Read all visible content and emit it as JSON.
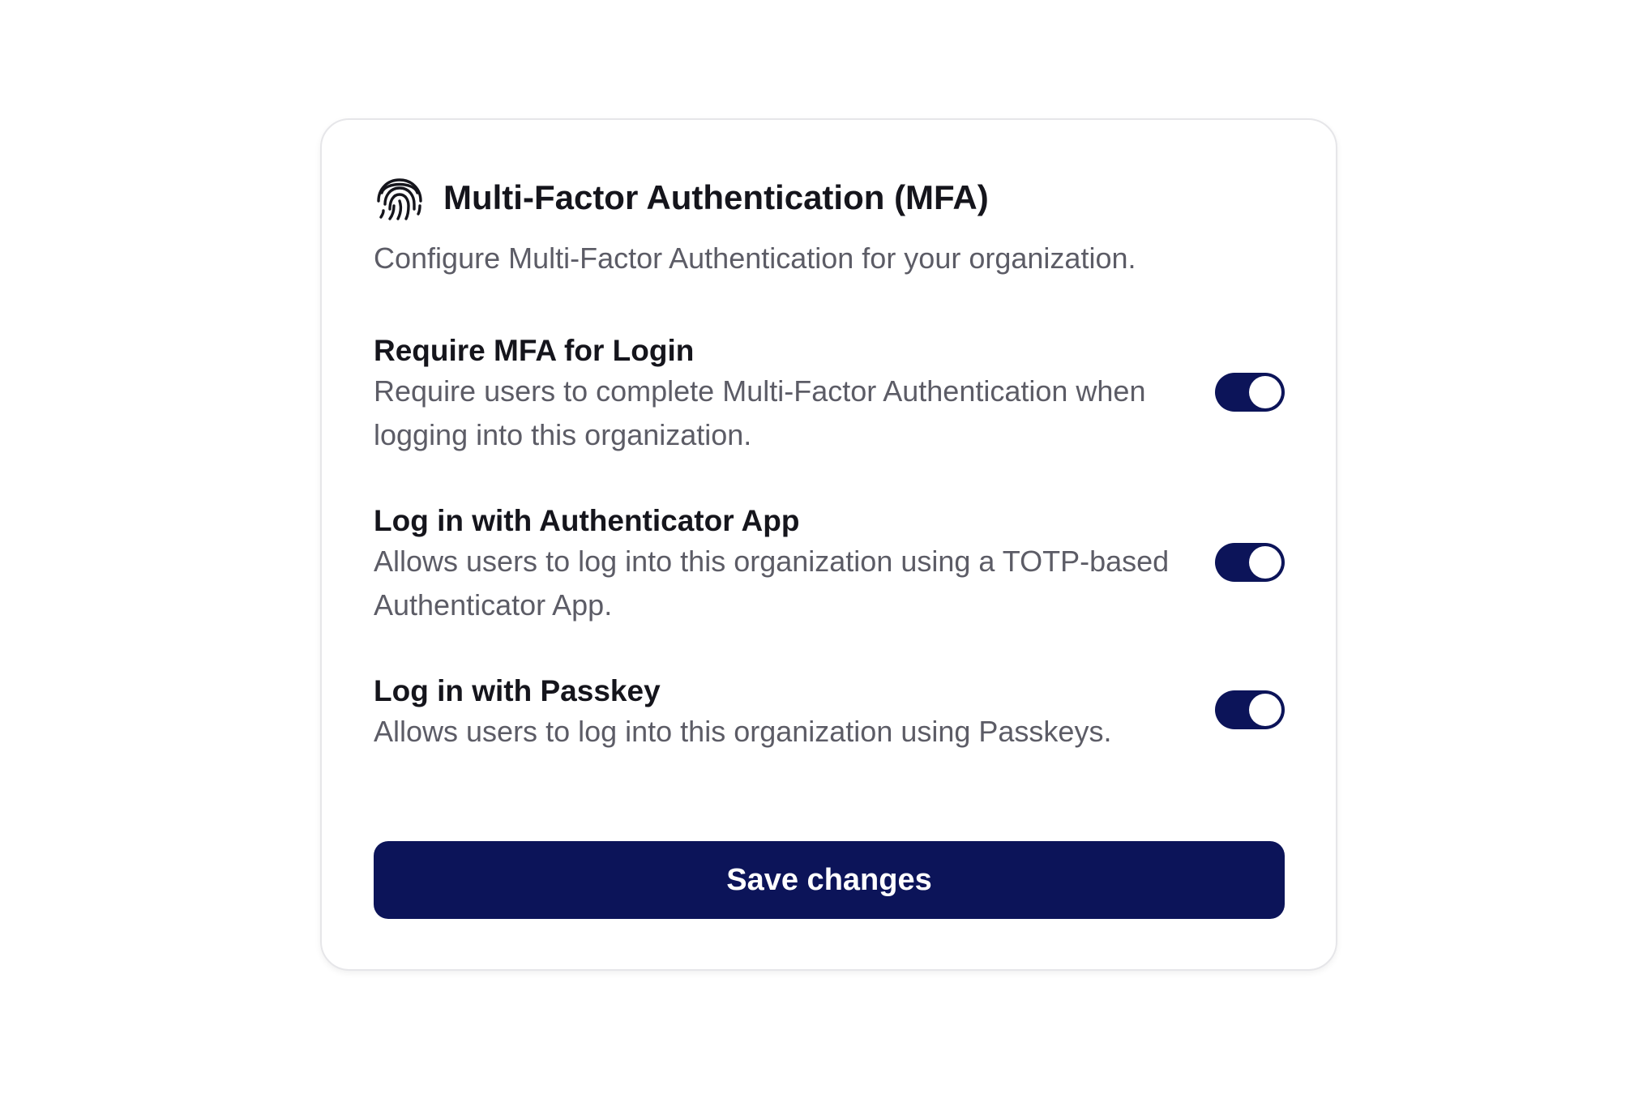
{
  "header": {
    "icon": "fingerprint-icon",
    "title": "Multi-Factor Authentication (MFA)",
    "subtitle": "Configure Multi-Factor Authentication for your organization."
  },
  "settings": [
    {
      "title": "Require MFA for Login",
      "description": "Require users to complete Multi-Factor Authentication when logging into this organization.",
      "enabled": true
    },
    {
      "title": "Log in with Authenticator App",
      "description": "Allows users to log into this organization using a TOTP-based Authenticator App.",
      "enabled": true
    },
    {
      "title": "Log in with Passkey",
      "description": "Allows users to log into this organization using Passkeys.",
      "enabled": true
    }
  ],
  "save_label": "Save changes",
  "colors": {
    "accent": "#0c1459",
    "text_primary": "#15151c",
    "text_secondary": "#5c5c66",
    "card_border": "#e6e6e9"
  }
}
